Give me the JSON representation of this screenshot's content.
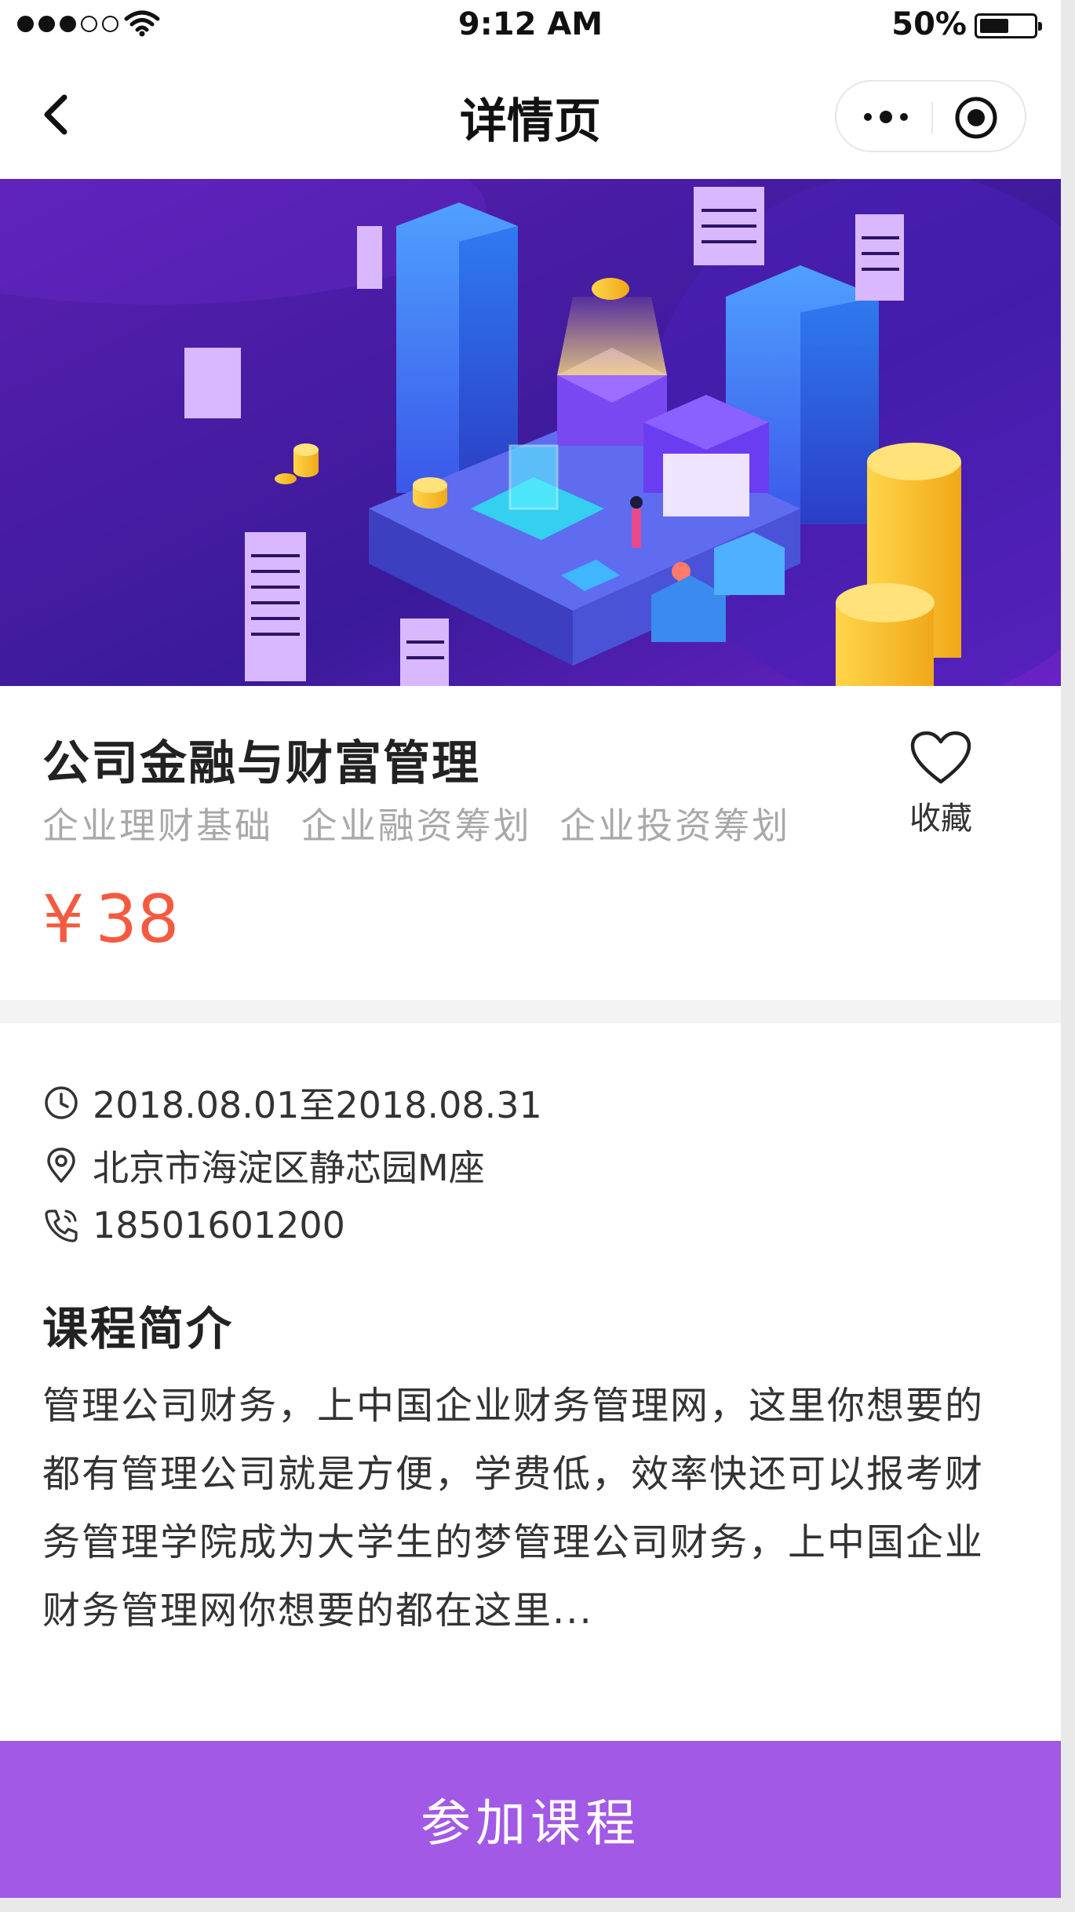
{
  "status_bar": {
    "time": "9:12 AM",
    "battery_percent": "50%",
    "battery_level": 0.5,
    "signal_bars_filled": 3,
    "signal_bars_total": 5
  },
  "nav": {
    "title": "详情页",
    "back_icon": "chevron-left-icon",
    "more_icon": "more-dots-icon",
    "close_icon": "target-circle-icon"
  },
  "banner": {
    "image": "isometric-finance-city-illustration",
    "colors": {
      "background_from": "#4b1fa8",
      "background_to": "#7a2bd0",
      "coin": "#f7c531"
    }
  },
  "course": {
    "title": "公司金融与财富管理",
    "tags": [
      "企业理财基础",
      "企业融资筹划",
      "企业投资筹划"
    ],
    "price_symbol": "¥",
    "price_value": "38",
    "favorite_label": "收藏"
  },
  "details": {
    "date_range": "2018.08.01至2018.08.31",
    "address": "北京市海淀区静芯园M座",
    "phone": "18501601200"
  },
  "intro": {
    "heading": "课程简介",
    "body": "管理公司财务，上中国企业财务管理网，这里你想要的都有管理公司就是方便，学费低，效率快还可以报考财务管理学院成为大学生的梦管理公司财务，上中国企业财务管理网你想要的都在这里..."
  },
  "action": {
    "join_label": "参加课程"
  },
  "colors": {
    "accent": "#a259e6",
    "price": "#f45a40",
    "tag_text": "#a9a9a9"
  }
}
